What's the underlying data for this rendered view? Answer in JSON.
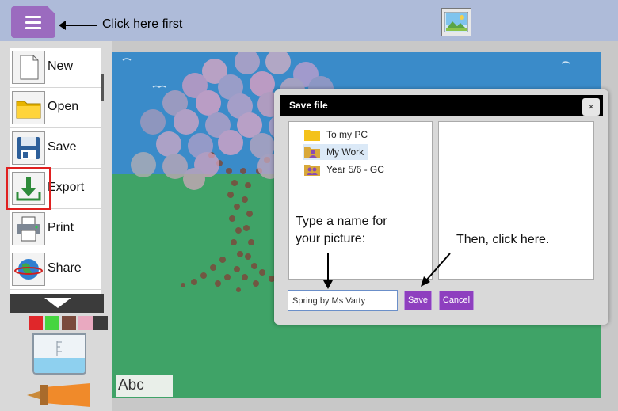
{
  "topbar": {
    "menu_icon": "hamburger-icon",
    "hint": "Click here first",
    "picture_icon": "picture-icon"
  },
  "menu": {
    "items": [
      {
        "label": "New",
        "icon": "new-page-icon"
      },
      {
        "label": "Open",
        "icon": "folder-icon"
      },
      {
        "label": "Save",
        "icon": "floppy-disk-icon"
      },
      {
        "label": "Export",
        "icon": "download-icon"
      },
      {
        "label": "Print",
        "icon": "printer-icon"
      },
      {
        "label": "Share",
        "icon": "globe-icon"
      }
    ]
  },
  "palette": {
    "colors": [
      "#e0272a",
      "#45d540",
      "#7a4a3c",
      "#e9a9c0",
      "#3b3b3b"
    ]
  },
  "canvas": {
    "text_tool": "Abc"
  },
  "dialog": {
    "title": "Save file",
    "close": "×",
    "folders": [
      {
        "label": "To my PC",
        "selected": false
      },
      {
        "label": "My Work",
        "selected": true
      },
      {
        "label": "Year 5/6 - GC",
        "selected": false
      }
    ],
    "filename": "Spring by Ms Varty",
    "save_label": "Save",
    "cancel_label": "Cancel",
    "note_name": "Type a name for your picture:",
    "note_click": "Then, click here."
  }
}
